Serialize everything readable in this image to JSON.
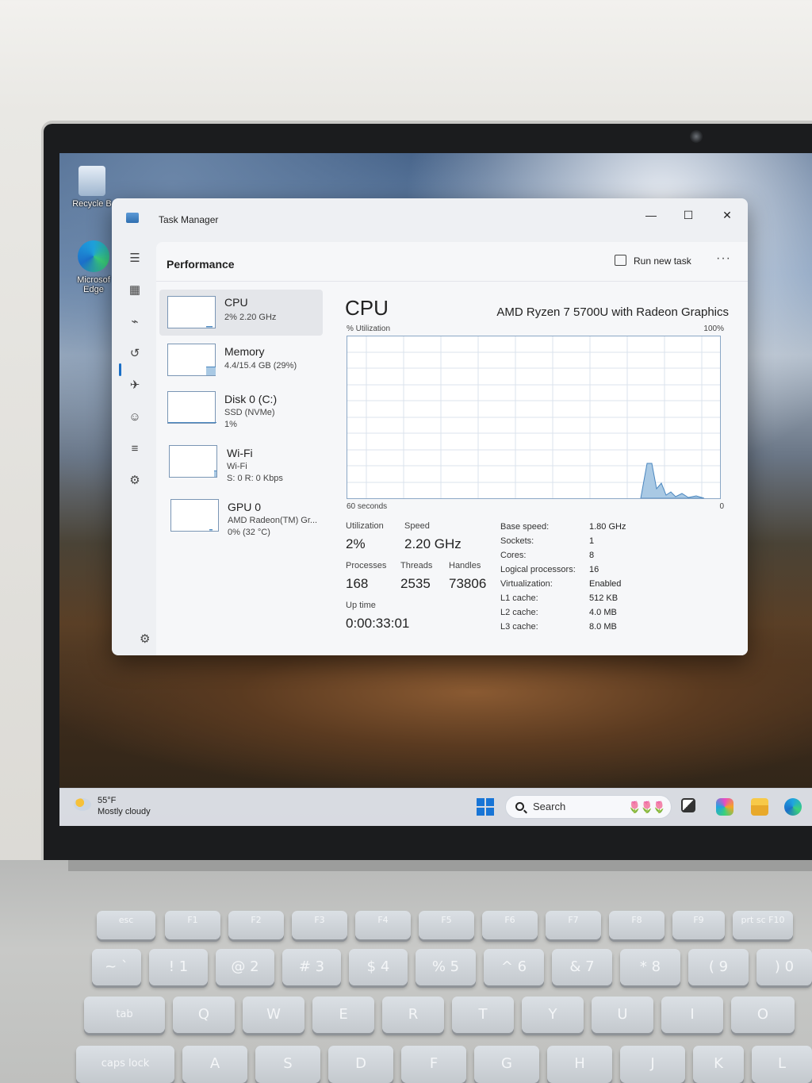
{
  "desktop": {
    "icons": [
      {
        "label": "Recycle B"
      },
      {
        "label": "Microsof Edge"
      }
    ]
  },
  "taskbar": {
    "weather_temp": "55°F",
    "weather_desc": "Mostly cloudy",
    "search_placeholder": "Search"
  },
  "task_manager": {
    "window_title": "Task Manager",
    "controls": {
      "minimize": "—",
      "maximize": "☐",
      "close": "✕"
    },
    "page_title": "Performance",
    "run_new_task": "Run new task",
    "more": "···",
    "sidebar": [
      {
        "name": "CPU",
        "line1": "2% 2.20 GHz",
        "line2": "",
        "level": 0.05
      },
      {
        "name": "Memory",
        "line1": "4.4/15.4 GB (29%)",
        "line2": "",
        "level": 0.29
      },
      {
        "name": "Disk 0 (C:)",
        "line1": "SSD (NVMe)",
        "line2": "1%",
        "level": 0.01
      },
      {
        "name": "Wi-Fi",
        "line1": "Wi-Fi",
        "line2": "S: 0 R: 0 Kbps",
        "level": 0.02
      },
      {
        "name": "GPU 0",
        "line1": "AMD Radeon(TM) Gr...",
        "line2": "0% (32 °C)",
        "level": 0.0
      }
    ],
    "detail": {
      "heading": "CPU",
      "model": "AMD Ryzen 7 5700U with Radeon Graphics",
      "graph_label_left": "% Utilization",
      "graph_label_right": "100%",
      "axis_left": "60 seconds",
      "axis_right": "0",
      "stats": {
        "utilization_label": "Utilization",
        "utilization": "2%",
        "speed_label": "Speed",
        "speed": "2.20 GHz",
        "processes_label": "Processes",
        "processes": "168",
        "threads_label": "Threads",
        "threads": "2535",
        "handles_label": "Handles",
        "handles": "73806",
        "uptime_label": "Up time",
        "uptime": "0:00:33:01"
      },
      "specs": [
        {
          "label": "Base speed:",
          "value": "1.80 GHz"
        },
        {
          "label": "Sockets:",
          "value": "1"
        },
        {
          "label": "Cores:",
          "value": "8"
        },
        {
          "label": "Logical processors:",
          "value": "16"
        },
        {
          "label": "Virtualization:",
          "value": "Enabled"
        },
        {
          "label": "L1 cache:",
          "value": "512 KB"
        },
        {
          "label": "L2 cache:",
          "value": "4.0 MB"
        },
        {
          "label": "L3 cache:",
          "value": "8.0 MB"
        }
      ]
    }
  },
  "keyboard": {
    "fn_row": [
      "esc",
      "F1",
      "F2",
      "F3",
      "F4",
      "F5",
      "F6",
      "F7",
      "F8",
      "F9",
      "prt sc F10"
    ],
    "num_row": [
      "~ `",
      "! 1",
      "@ 2",
      "# 3",
      "$ 4",
      "% 5",
      "^ 6",
      "& 7",
      "* 8",
      "( 9",
      ") 0"
    ],
    "qwerty_row": [
      "tab",
      "Q",
      "W",
      "E",
      "R",
      "T",
      "Y",
      "U",
      "I",
      "O"
    ],
    "home_row": [
      "caps lock",
      "A",
      "S",
      "D",
      "F",
      "G",
      "H",
      "J",
      "K",
      "L"
    ]
  },
  "colors": {
    "accent": "#1a6fc6",
    "graph_line": "#4b87bf",
    "graph_fill": "#a9c9e4"
  }
}
